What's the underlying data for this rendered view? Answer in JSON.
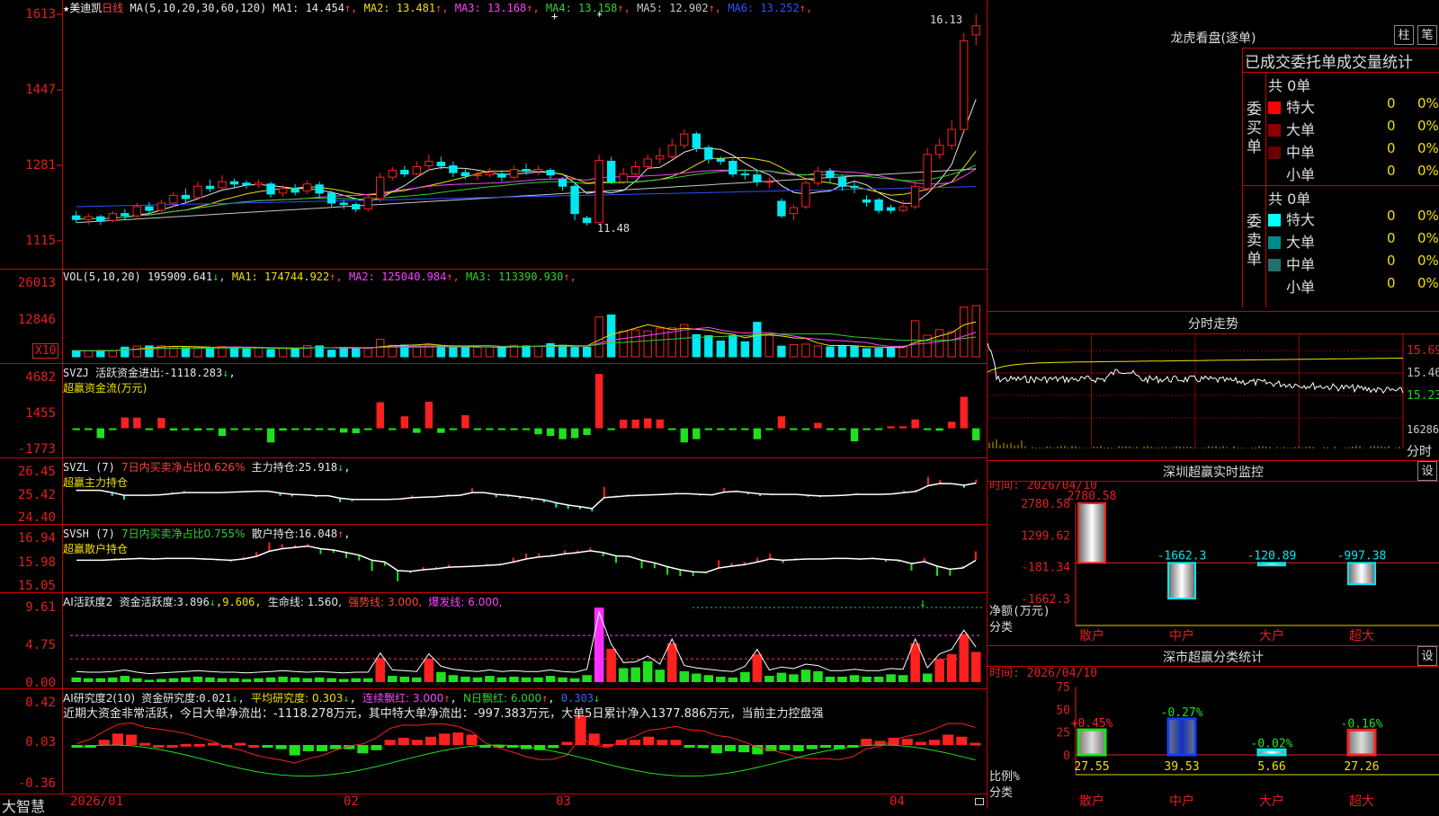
{
  "stock": {
    "star": "★",
    "name": "美迪凯",
    "period": "日线"
  },
  "kline": {
    "ma_label": "MA(5,10,20,30,60,120)",
    "ma_values": [
      {
        "label": "MA1:",
        "value": "14.454",
        "arrow": "↑",
        "color": "#e8e8e8"
      },
      {
        "label": "MA2:",
        "value": "13.481",
        "arrow": "↑",
        "color": "#f0e000"
      },
      {
        "label": "MA3:",
        "value": "13.168",
        "arrow": "↑",
        "color": "#ff40ff"
      },
      {
        "label": "MA4:",
        "value": "13.158",
        "arrow": "↑",
        "color": "#30d030"
      },
      {
        "label": "MA5:",
        "value": "12.902",
        "arrow": "↑",
        "color": "#c8c8c8"
      },
      {
        "label": "MA6:",
        "value": "13.252",
        "arrow": "↑",
        "color": "#3050ff"
      }
    ],
    "y_ticks": [
      "1613",
      "1447",
      "1281",
      "1115"
    ],
    "high_label": "16.13",
    "low_label": "11.48"
  },
  "volume": {
    "label": "VOL(5,10,20)",
    "value": "195909.641",
    "arrow": "↓",
    "ma": [
      {
        "label": "MA1:",
        "value": "174744.922",
        "arrow": "↑",
        "color": "#f0e000"
      },
      {
        "label": "MA2:",
        "value": "125040.984",
        "arrow": "↑",
        "color": "#ff40ff"
      },
      {
        "label": "MA3:",
        "value": "113390.930",
        "arrow": "↑",
        "color": "#30d030"
      }
    ],
    "y_ticks": [
      "26013",
      "12846"
    ],
    "unit": "X10"
  },
  "svzj": {
    "label": "SVZJ",
    "text": "活跃资金进出:",
    "value": "-1118.283",
    "arrow": "↓",
    "sub": "超赢资金流(万元)",
    "y_ticks": [
      "4682",
      "1455",
      "-1773"
    ]
  },
  "svzl": {
    "label": "SVZL (7)",
    "text": "7日内买卖净占比0.626%",
    "text2": "主力持仓:",
    "value": "25.918",
    "arrow": "↓",
    "sub": "超赢主力持仓",
    "y_ticks": [
      "26.45",
      "25.42",
      "24.40"
    ]
  },
  "svsh": {
    "label": "SVSH (7)",
    "text": "7日内买卖净占比0.755%",
    "text2": "散户持仓:",
    "value": "16.048",
    "arrow": "↑",
    "sub": "超赢散户持仓",
    "y_ticks": [
      "16.94",
      "15.98",
      "15.05"
    ]
  },
  "ai_active": {
    "label": "AI活跃度2",
    "text": "资金活跃度:",
    "value": "3.896",
    "arrow": "↓",
    "v2": "9.606,",
    "life": "生命线: 1.560,",
    "strong": "强势线: 3.000,",
    "burst": "爆发线: 6.000,",
    "y_ticks": [
      "9.61",
      "4.75",
      "0.00"
    ]
  },
  "ai_research": {
    "label": "AI研究度2(10)",
    "text": "资金研究度:",
    "value": "0.021",
    "arrow": "↓",
    "avg": "平均研究度: 0.303",
    "avg_arrow": "↓",
    "cont": "连续飘红: 3.000",
    "cont_arrow": "↑",
    "nday": "N日飘红: 6.000",
    "nday_arrow": "↑",
    "last": "0.303",
    "last_arrow": "↓",
    "comment": "近期大资金非常活跃，今日大单净流出：-1118.278万元，其中特大单净流出：-997.383万元，大单5日累计净入1377.886万元，当前主力控盘强",
    "y_ticks": [
      "0.42",
      "0.03",
      "-0.36"
    ]
  },
  "x_axis": {
    "labels": [
      "2026/01",
      "02",
      "03",
      "04"
    ],
    "brand": "大智慧"
  },
  "dragon": {
    "title": "龙虎看盘(逐单)",
    "btn_bar": "柱",
    "btn_pen": "笔",
    "header": "已成交委托单成交量统计",
    "buy": {
      "side": "委买单",
      "count": "共 0单",
      "rows": [
        {
          "name": "特大",
          "qty": "0",
          "pct": "0%",
          "color": "#ff0000"
        },
        {
          "name": "大单",
          "qty": "0",
          "pct": "0%",
          "color": "#8b0000"
        },
        {
          "name": "中单",
          "qty": "0",
          "pct": "0%",
          "color": "#6a0000"
        },
        {
          "name": "小单",
          "qty": "0",
          "pct": "0%",
          "color": "#000000"
        }
      ]
    },
    "sell": {
      "side": "委卖单",
      "count": "共 0单",
      "rows": [
        {
          "name": "特大",
          "qty": "0",
          "pct": "0%",
          "color": "#00ffff"
        },
        {
          "name": "大单",
          "qty": "0",
          "pct": "0%",
          "color": "#008b8b"
        },
        {
          "name": "中单",
          "qty": "0",
          "pct": "0%",
          "color": "#207070"
        },
        {
          "name": "小单",
          "qty": "0",
          "pct": "0%",
          "color": "#000000"
        }
      ]
    }
  },
  "intraday": {
    "title": "分时走势",
    "y_labels": [
      "15.69",
      "15.46",
      "15.23"
    ],
    "vol_label": "16286",
    "footer": "分时"
  },
  "monitor": {
    "title": "深圳超赢实时监控",
    "settings": "设",
    "time_label": "时间: 2026/04/10",
    "unit_label": "净额(万元)",
    "cat_label": "分类",
    "y_ticks": [
      "2780.58",
      "1299.62",
      "-181.34",
      "-1662.3"
    ],
    "ylim": [
      -1662.3,
      2780.58
    ]
  },
  "classify": {
    "title": "深市超赢分类统计",
    "settings": "设",
    "time_label": "时间: 2026/04/10",
    "unit_label": "比例%",
    "cat_label": "分类",
    "y_ticks": [
      "75",
      "50",
      "25",
      "0"
    ],
    "ylim": [
      0,
      75
    ]
  },
  "chart_data": [
    {
      "type": "candlestick",
      "title": "美迪凯 日线",
      "ylim": [
        11.15,
        16.13
      ],
      "ohlc": [
        [
          11.7,
          11.62,
          11.55,
          11.8
        ],
        [
          11.62,
          11.68,
          11.5,
          11.75
        ],
        [
          11.68,
          11.58,
          11.5,
          11.72
        ],
        [
          11.6,
          11.75,
          11.55,
          11.8
        ],
        [
          11.75,
          11.7,
          11.62,
          11.85
        ],
        [
          11.7,
          11.9,
          11.62,
          11.98
        ],
        [
          11.9,
          11.82,
          11.75,
          12.0
        ],
        [
          11.82,
          11.98,
          11.78,
          12.05
        ],
        [
          11.98,
          12.15,
          11.9,
          12.22
        ],
        [
          12.15,
          12.08,
          12.0,
          12.3
        ],
        [
          12.1,
          12.35,
          12.05,
          12.45
        ],
        [
          12.35,
          12.3,
          12.22,
          12.5
        ],
        [
          12.32,
          12.45,
          12.28,
          12.6
        ],
        [
          12.45,
          12.4,
          12.3,
          12.52
        ],
        [
          12.42,
          12.38,
          12.3,
          12.48
        ],
        [
          12.38,
          12.42,
          12.32,
          12.5
        ],
        [
          12.4,
          12.18,
          12.1,
          12.45
        ],
        [
          12.2,
          12.3,
          12.12,
          12.38
        ],
        [
          12.3,
          12.22,
          12.15,
          12.4
        ],
        [
          12.25,
          12.4,
          12.18,
          12.48
        ],
        [
          12.38,
          12.2,
          12.1,
          12.45
        ],
        [
          12.2,
          11.98,
          11.9,
          12.25
        ],
        [
          11.98,
          11.95,
          11.85,
          12.05
        ],
        [
          11.95,
          11.85,
          11.78,
          12.0
        ],
        [
          11.85,
          12.1,
          11.8,
          12.15
        ],
        [
          12.08,
          12.55,
          12.0,
          12.65
        ],
        [
          12.55,
          12.7,
          12.48,
          12.78
        ],
        [
          12.7,
          12.62,
          12.55,
          12.8
        ],
        [
          12.62,
          12.78,
          12.6,
          12.9
        ],
        [
          12.8,
          12.9,
          12.7,
          13.05
        ],
        [
          12.88,
          12.8,
          12.72,
          13.0
        ],
        [
          12.8,
          12.65,
          12.55,
          12.9
        ],
        [
          12.65,
          12.58,
          12.5,
          12.75
        ],
        [
          12.58,
          12.6,
          12.48,
          12.7
        ],
        [
          12.6,
          12.65,
          12.55,
          12.75
        ],
        [
          12.62,
          12.55,
          12.45,
          12.7
        ],
        [
          12.55,
          12.72,
          12.5,
          12.8
        ],
        [
          12.72,
          12.68,
          12.6,
          12.85
        ],
        [
          12.68,
          12.72,
          12.6,
          12.8
        ],
        [
          12.7,
          12.6,
          12.5,
          12.75
        ],
        [
          12.5,
          12.35,
          12.25,
          12.55
        ],
        [
          12.35,
          11.75,
          11.6,
          12.4
        ],
        [
          11.65,
          11.55,
          11.48,
          11.7
        ],
        [
          11.55,
          12.92,
          11.55,
          13.05
        ],
        [
          12.9,
          12.45,
          12.4,
          13.0
        ],
        [
          12.45,
          12.62,
          12.4,
          12.75
        ],
        [
          12.62,
          12.78,
          12.55,
          12.9
        ],
        [
          12.78,
          12.95,
          12.72,
          13.05
        ],
        [
          12.95,
          13.02,
          12.85,
          13.2
        ],
        [
          13.0,
          13.25,
          12.95,
          13.4
        ],
        [
          13.25,
          13.5,
          13.18,
          13.6
        ],
        [
          13.5,
          13.2,
          13.1,
          13.55
        ],
        [
          13.2,
          12.95,
          12.85,
          13.25
        ],
        [
          12.95,
          12.9,
          12.82,
          13.0
        ],
        [
          12.9,
          12.62,
          12.55,
          12.95
        ],
        [
          12.62,
          12.6,
          12.5,
          12.72
        ],
        [
          12.6,
          12.45,
          12.35,
          12.7
        ],
        [
          12.45,
          12.45,
          12.3,
          12.55
        ],
        [
          12.02,
          11.7,
          11.65,
          12.08
        ],
        [
          11.75,
          11.88,
          11.6,
          11.95
        ],
        [
          11.9,
          12.42,
          11.85,
          12.52
        ],
        [
          12.42,
          12.68,
          12.35,
          12.78
        ],
        [
          12.68,
          12.55,
          12.42,
          12.75
        ],
        [
          12.55,
          12.35,
          12.25,
          12.6
        ],
        [
          12.35,
          12.32,
          12.2,
          12.45
        ],
        [
          12.05,
          12.0,
          11.9,
          12.15
        ],
        [
          12.05,
          11.82,
          11.75,
          12.1
        ],
        [
          11.88,
          11.82,
          11.75,
          11.95
        ],
        [
          11.82,
          11.9,
          11.78,
          12.05
        ],
        [
          11.9,
          12.35,
          11.85,
          12.45
        ],
        [
          12.3,
          13.05,
          12.25,
          13.2
        ],
        [
          13.05,
          13.25,
          12.95,
          13.4
        ],
        [
          13.25,
          13.6,
          13.15,
          13.8
        ],
        [
          13.6,
          15.55,
          13.55,
          15.72
        ],
        [
          15.68,
          15.88,
          15.45,
          16.13
        ]
      ]
    },
    {
      "type": "bar",
      "title": "VOL(5,10,20)",
      "ylim": [
        0,
        28000
      ],
      "values": [
        2400,
        2300,
        2500,
        2400,
        3800,
        4200,
        4300,
        4300,
        3900,
        3600,
        3600,
        3600,
        4000,
        3700,
        3100,
        3600,
        2900,
        3400,
        3000,
        4400,
        4300,
        2600,
        3700,
        3200,
        3300,
        6900,
        4500,
        4600,
        4300,
        4800,
        4300,
        3700,
        3700,
        3700,
        3900,
        3700,
        4500,
        4300,
        4200,
        5200,
        4500,
        3700,
        3800,
        15700,
        16500,
        10000,
        10600,
        10200,
        11300,
        11400,
        12700,
        8700,
        8300,
        6200,
        8400,
        5900,
        13600,
        8800,
        4200,
        4800,
        5000,
        4300,
        3900,
        4400,
        4200,
        3200,
        3300,
        3400,
        4200,
        14200,
        8500,
        10700,
        9900,
        19600,
        20200
      ]
    },
    {
      "type": "bar",
      "title": "SVZJ 超赢资金流(万元)",
      "ylim": [
        -1773,
        4682
      ],
      "values": [
        -60,
        -55,
        -900,
        -30,
        1000,
        980,
        -80,
        950,
        -200,
        -40,
        -200,
        -150,
        -700,
        -60,
        -30,
        -60,
        -1300,
        -200,
        -100,
        -120,
        -50,
        -30,
        -400,
        -450,
        -30,
        2400,
        -30,
        1100,
        -420,
        2450,
        -420,
        -80,
        1200,
        -30,
        -80,
        -60,
        -150,
        -80,
        -550,
        -700,
        -1000,
        -900,
        -620,
        5000,
        -80,
        800,
        800,
        920,
        820,
        -60,
        -1300,
        -1000,
        -40,
        -60,
        -60,
        -90,
        -1000,
        -80,
        1100,
        -150,
        -120,
        500,
        -80,
        -160,
        -1200,
        -60,
        -120,
        180,
        180,
        820,
        -120,
        -220,
        600,
        2900,
        -1118.283
      ]
    },
    {
      "type": "line",
      "title": "SVZL 超赢主力持仓",
      "ylim": [
        24.4,
        26.45
      ],
      "values": [
        25.6,
        25.6,
        25.6,
        25.5,
        25.38,
        25.38,
        25.38,
        25.4,
        25.45,
        25.5,
        25.5,
        25.5,
        25.5,
        25.52,
        25.54,
        25.56,
        25.56,
        25.48,
        25.42,
        25.4,
        25.36,
        25.36,
        25.25,
        25.2,
        25.2,
        25.2,
        25.2,
        25.22,
        25.28,
        25.3,
        25.32,
        25.36,
        25.38,
        25.5,
        25.5,
        25.42,
        25.38,
        25.32,
        25.25,
        25.18,
        25.05,
        24.95,
        24.88,
        24.8,
        25.28,
        25.32,
        25.36,
        25.38,
        25.4,
        25.42,
        25.45,
        25.45,
        25.42,
        25.4,
        25.52,
        25.55,
        25.5,
        25.44,
        25.42,
        25.42,
        25.42,
        25.38,
        25.35,
        25.36,
        25.38,
        25.42,
        25.42,
        25.42,
        25.44,
        25.5,
        25.55,
        25.8,
        25.9,
        25.89,
        25.82,
        25.918
      ]
    },
    {
      "type": "line",
      "title": "SVSH 超赢散户持仓",
      "ylim": [
        15.05,
        16.94
      ],
      "values": [
        16.05,
        16.05,
        16.05,
        16.08,
        16.1,
        16.12,
        16.1,
        16.12,
        16.12,
        16.12,
        16.1,
        16.08,
        16.05,
        16.1,
        16.2,
        16.4,
        16.5,
        16.55,
        16.6,
        16.5,
        16.45,
        16.35,
        16.25,
        16.05,
        15.98,
        15.65,
        15.62,
        15.68,
        15.72,
        15.78,
        15.8,
        15.82,
        15.85,
        15.88,
        15.98,
        16.1,
        16.18,
        16.22,
        16.3,
        16.35,
        16.42,
        16.35,
        16.22,
        16.2,
        16.05,
        15.95,
        15.8,
        15.68,
        15.6,
        15.58,
        15.75,
        15.82,
        15.88,
        15.98,
        16.1,
        16.05,
        16.08,
        16.1,
        16.1,
        16.12,
        16.12,
        16.1,
        16.12,
        16.08,
        16.05,
        15.92,
        16.0,
        15.82,
        15.7,
        15.75,
        16.048
      ]
    },
    {
      "type": "bar",
      "title": "AI活跃度2",
      "ylim": [
        0,
        9.61
      ],
      "values": [
        0.6,
        0.5,
        0.5,
        0.6,
        0.8,
        0.5,
        0.3,
        0.4,
        0.5,
        0.6,
        0.7,
        0.6,
        0.5,
        0.5,
        0.4,
        0.5,
        0.6,
        0.7,
        0.6,
        0.5,
        0.6,
        0.5,
        0.4,
        0.5,
        0.5,
        3.1,
        0.8,
        0.7,
        0.6,
        3.0,
        1.3,
        0.9,
        0.7,
        0.6,
        0.8,
        0.6,
        0.7,
        0.6,
        0.6,
        0.8,
        0.6,
        0.5,
        0.9,
        9.6,
        4.3,
        1.8,
        1.9,
        2.7,
        1.6,
        5.0,
        1.4,
        1.1,
        0.9,
        0.7,
        0.6,
        1.3,
        3.6,
        0.8,
        1.2,
        1.0,
        1.6,
        1.4,
        0.7,
        0.7,
        0.9,
        0.7,
        0.7,
        1.0,
        0.9,
        5.0,
        1.1,
        3.0,
        3.6,
        6.2,
        3.896
      ]
    },
    {
      "type": "bar",
      "title": "AI研究度2(10)",
      "ylim": [
        -0.36,
        0.42
      ],
      "values": [
        -0.01,
        -0.01,
        0.05,
        0.11,
        0.1,
        0.02,
        0.0,
        0.0,
        0.01,
        0.01,
        0.02,
        0.0,
        0.02,
        0.0,
        -0.02,
        -0.04,
        -0.1,
        -0.06,
        -0.06,
        -0.04,
        -0.04,
        -0.08,
        -0.05,
        0.05,
        0.07,
        0.05,
        0.08,
        0.11,
        0.12,
        0.1,
        -0.01,
        -0.02,
        -0.02,
        -0.04,
        -0.05,
        -0.03,
        0.03,
        0.28,
        0.11,
        0.01,
        0.05,
        0.05,
        0.08,
        0.05,
        0.05,
        -0.02,
        -0.03,
        -0.08,
        -0.06,
        -0.07,
        -0.09,
        -0.06,
        -0.05,
        -0.06,
        -0.04,
        -0.02,
        -0.04,
        -0.02,
        0.06,
        0.04,
        0.07,
        0.06,
        0.03,
        0.05,
        0.1,
        0.08,
        0.021
      ]
    },
    {
      "type": "bar",
      "title": "深圳超赢实时监控",
      "categories": [
        "散户",
        "中户",
        "大户",
        "超大"
      ],
      "values": [
        2780.58,
        -1662.3,
        -120.89,
        -997.38
      ]
    },
    {
      "type": "bar",
      "title": "深市超赢分类统计",
      "categories": [
        "散户",
        "中户",
        "大户",
        "超大"
      ],
      "values": [
        27.55,
        39.53,
        5.66,
        27.26
      ],
      "changes": [
        "+0.45%",
        "-0.27%",
        "-0.02%",
        "-0.16%"
      ]
    }
  ]
}
